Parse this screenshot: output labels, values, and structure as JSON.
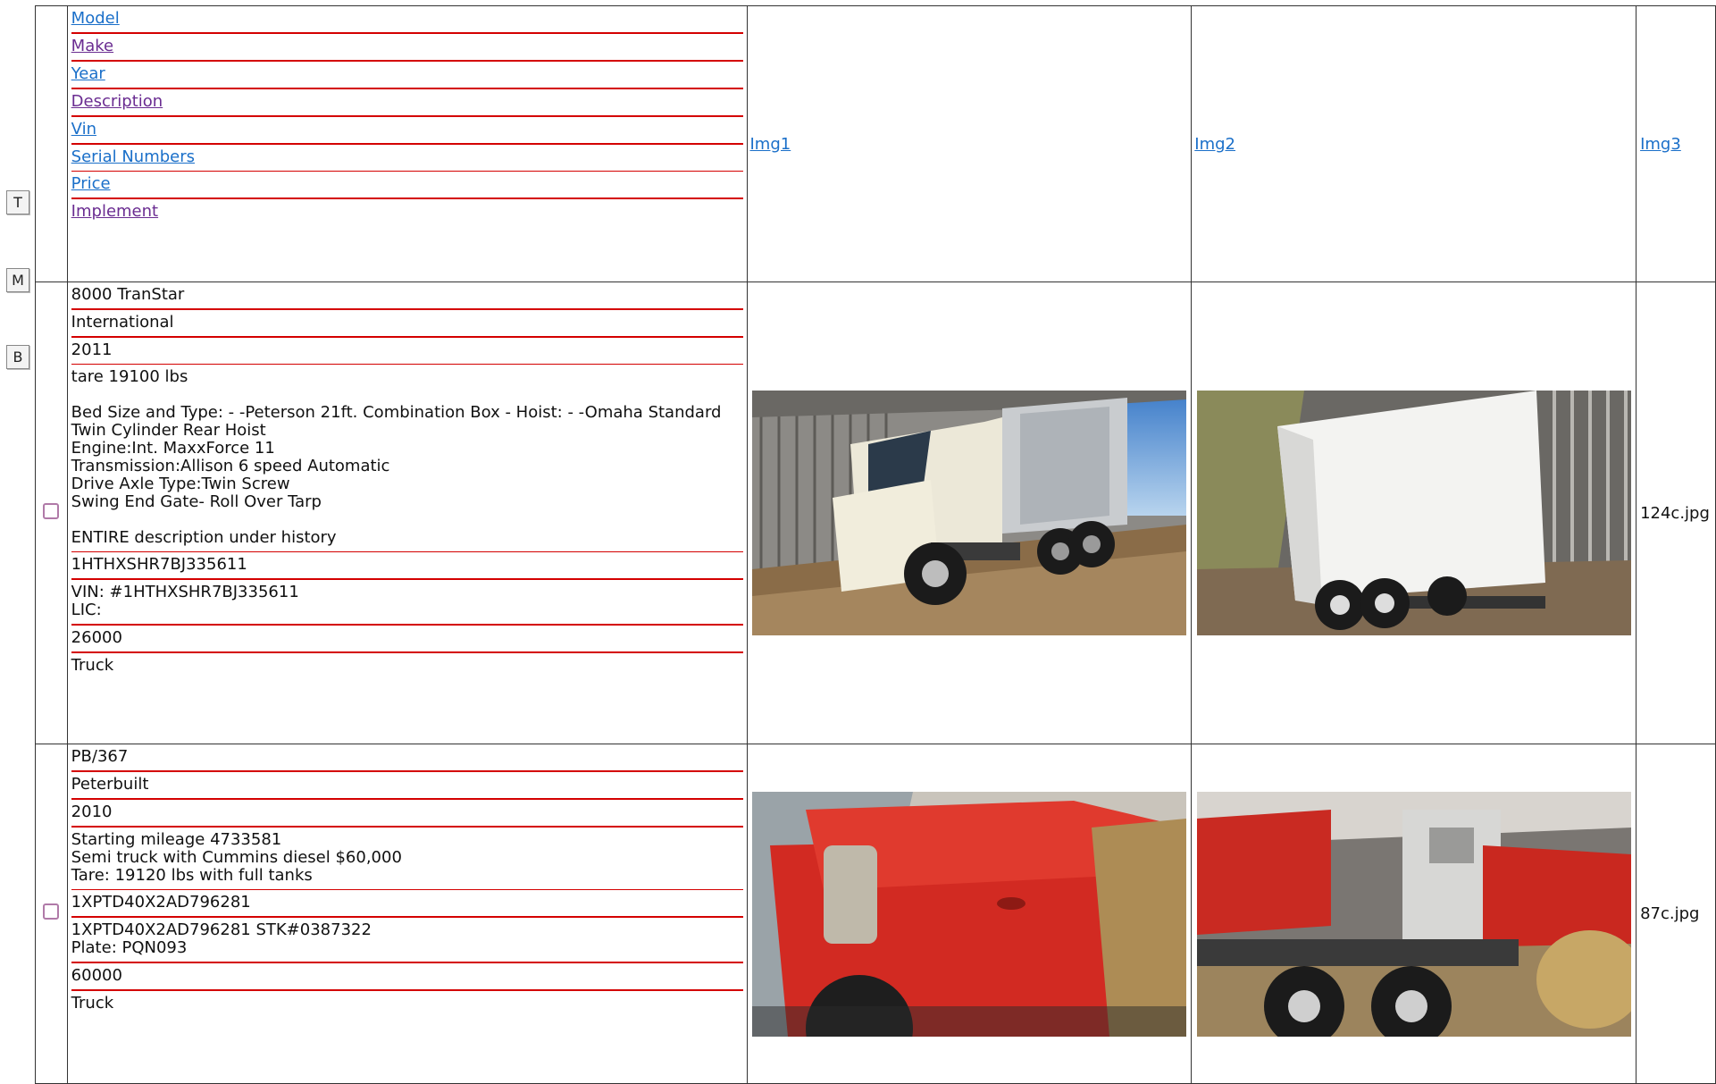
{
  "nav": {
    "top": "T",
    "middle": "M",
    "bottom": "B"
  },
  "header": {
    "fields": [
      "Model",
      "Make",
      "Year",
      "Description",
      "Vin",
      "Serial Numbers",
      "Price",
      "Implement"
    ],
    "img1": "Img1",
    "img2": "Img2",
    "img3": "Img3"
  },
  "rows": [
    {
      "model": "8000 TranStar",
      "make": "International",
      "year": "2011",
      "description": "tare 19100 lbs\n\nBed Size and Type: - -Peterson 21ft. Combination Box - Hoist: - -Omaha Standard Twin Cylinder Rear Hoist\nEngine:Int. MaxxForce 11\nTransmission:Allison 6 speed Automatic\nDrive Axle Type:Twin Screw\nSwing End Gate- Roll Over Tarp\n\nENTIRE description under history",
      "vin": "1HTHXSHR7BJ335611",
      "serial": "VIN: #1HTHXSHR7BJ335611\nLIC:",
      "price": "26000",
      "implement": "Truck",
      "img3": "124c.jpg"
    },
    {
      "model": "PB/367",
      "make": "Peterbuilt",
      "year": "2010",
      "description": "Starting mileage 4733581\nSemi truck with Cummins diesel $60,000\nTare: 19120 lbs with full tanks",
      "vin": "1XPTD40X2AD796281",
      "serial": "1XPTD40X2AD796281 STK#0387322\nPlate: PQN093",
      "price": "60000",
      "implement": "Truck",
      "img3": "87c.jpg"
    }
  ]
}
